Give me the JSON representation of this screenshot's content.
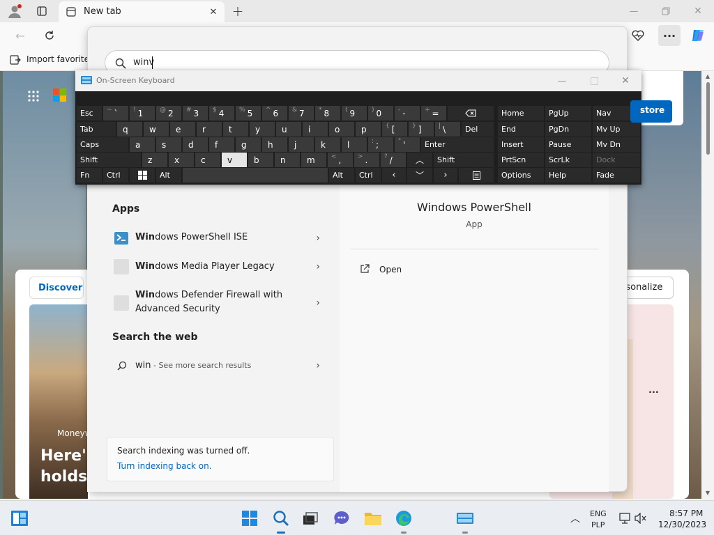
{
  "browser": {
    "tab_title": "New tab",
    "favorites_label": "Import favorites",
    "search_text": "winv",
    "discover_label": "Discover",
    "personalize_label": "ersonalize",
    "store_label": "store",
    "more_label": "...",
    "news_source": "Moneyw",
    "headline_1": "Here's",
    "headline_2": "holds"
  },
  "osk": {
    "title": "On-Screen Keyboard",
    "row1": [
      {
        "s": "~",
        "m": "`"
      },
      {
        "s": "!",
        "m": "1"
      },
      {
        "s": "@",
        "m": "2"
      },
      {
        "s": "#",
        "m": "3"
      },
      {
        "s": "$",
        "m": "4"
      },
      {
        "s": "%",
        "m": "5"
      },
      {
        "s": "^",
        "m": "6"
      },
      {
        "s": "&",
        "m": "7"
      },
      {
        "s": "*",
        "m": "8"
      },
      {
        "s": "(",
        "m": "9"
      },
      {
        "s": ")",
        "m": "0"
      },
      {
        "s": "-",
        "m": "-"
      },
      {
        "s": "+",
        "m": "="
      }
    ],
    "row2": [
      {
        "s": "",
        "m": "q"
      },
      {
        "s": "",
        "m": "w"
      },
      {
        "s": "",
        "m": "e"
      },
      {
        "s": "",
        "m": "r"
      },
      {
        "s": "",
        "m": "t"
      },
      {
        "s": "",
        "m": "y"
      },
      {
        "s": "",
        "m": "u"
      },
      {
        "s": "",
        "m": "i"
      },
      {
        "s": "",
        "m": "o"
      },
      {
        "s": "",
        "m": "p"
      },
      {
        "s": "{",
        "m": "["
      },
      {
        "s": "}",
        "m": "]"
      },
      {
        "s": "|",
        "m": "\\"
      }
    ],
    "row3": [
      {
        "s": "",
        "m": "a"
      },
      {
        "s": "",
        "m": "s"
      },
      {
        "s": "",
        "m": "d"
      },
      {
        "s": "",
        "m": "f"
      },
      {
        "s": "",
        "m": "g"
      },
      {
        "s": "",
        "m": "h"
      },
      {
        "s": "",
        "m": "j"
      },
      {
        "s": "",
        "m": "k"
      },
      {
        "s": "",
        "m": "l"
      },
      {
        "s": ":",
        "m": ";"
      },
      {
        "s": "\"",
        "m": "'"
      }
    ],
    "row4": [
      {
        "s": "",
        "m": "z"
      },
      {
        "s": "",
        "m": "x"
      },
      {
        "s": "",
        "m": "c"
      },
      {
        "s": "",
        "m": "v"
      },
      {
        "s": "",
        "m": "b"
      },
      {
        "s": "",
        "m": "n"
      },
      {
        "s": "",
        "m": "m"
      },
      {
        "s": "<",
        "m": ","
      },
      {
        "s": ">",
        "m": "."
      },
      {
        "s": "?",
        "m": "/"
      }
    ],
    "keys": {
      "esc": "Esc",
      "tab": "Tab",
      "caps": "Caps",
      "shift": "Shift",
      "fn": "Fn",
      "ctrl": "Ctrl",
      "alt": "Alt",
      "del": "Del",
      "enter": "Enter",
      "home": "Home",
      "pgup": "PgUp",
      "nav": "Nav",
      "end": "End",
      "pgdn": "PgDn",
      "mvup": "Mv Up",
      "insert": "Insert",
      "pause": "Pause",
      "mvdn": "Mv Dn",
      "prtscn": "PrtScn",
      "scrlk": "ScrLk",
      "dock": "Dock",
      "options": "Options",
      "help": "Help",
      "fade": "Fade"
    }
  },
  "search": {
    "apps_heading": "Apps",
    "apps": [
      {
        "bold": "Win",
        "rest": "dows PowerShell ISE",
        "line2": ""
      },
      {
        "bold": "Win",
        "rest": "dows Media Player Legacy",
        "line2": ""
      },
      {
        "bold": "Win",
        "rest": "dows Defender Firewall with",
        "line2": "Advanced Security"
      }
    ],
    "web_heading": "Search the web",
    "web_query": "win",
    "web_suffix": " - See more search results",
    "notice_text": "Search indexing was turned off.",
    "notice_link": "Turn indexing back on.",
    "preview_title": "Windows PowerShell",
    "preview_type": "App",
    "open_label": "Open"
  },
  "tray": {
    "lang1": "ENG",
    "lang2": "PLP",
    "time": "8:57 PM",
    "date": "12/30/2023"
  },
  "colors": {
    "accent": "#0067c0",
    "osk_bg": "#1f1f1f",
    "osk_key": "#3a3a3a"
  }
}
